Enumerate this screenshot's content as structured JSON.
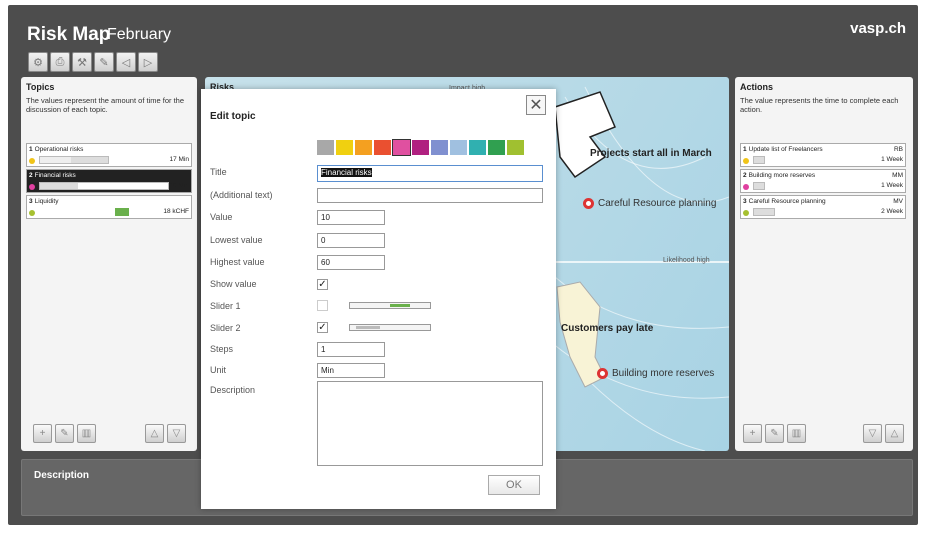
{
  "app": {
    "title": "Risk Map",
    "subtitle": "February",
    "brand": "vasp.ch"
  },
  "toolbar": {
    "icons": [
      "gear-icon",
      "print-icon",
      "tools-icon",
      "edit-icon",
      "back-icon",
      "forward-icon"
    ]
  },
  "topics": {
    "title": "Topics",
    "description": "The values represent the amount of time for the discussion of each topic.",
    "items": [
      {
        "num": "1",
        "label": "Operational risks",
        "value": "17 Min",
        "fraction": 0.45,
        "color": "#f0c419",
        "selected": false
      },
      {
        "num": "2",
        "label": "Financial risks",
        "value": "10 Min",
        "fraction": 0.3,
        "color": "#e040a0",
        "selected": true
      },
      {
        "num": "3",
        "label": "Liquidity",
        "value": "18 kCHF",
        "fraction": 0.6,
        "color": "#a6c030",
        "selected": false
      }
    ]
  },
  "actions": {
    "title": "Actions",
    "description": "The value represents the time to complete each action.",
    "items": [
      {
        "num": "1",
        "label": "Update list of Freelancers",
        "owner": "RB",
        "value": "1 Week",
        "color": "#f0c419"
      },
      {
        "num": "2",
        "label": "Building more reserves",
        "owner": "MM",
        "value": "1 Week",
        "color": "#e040a0"
      },
      {
        "num": "3",
        "label": "Careful Resource planning",
        "owner": "MV",
        "value": "2 Week",
        "color": "#a6c030"
      }
    ]
  },
  "risks": {
    "title": "Risks",
    "impact": "Impact high",
    "likelihood": "Likelihood high",
    "labels": [
      "Projects start all in March",
      "Customers pay late"
    ],
    "actions": [
      "Careful Resource planning",
      "Building more reserves"
    ]
  },
  "description": {
    "title": "Description"
  },
  "dialog": {
    "title": "Edit topic",
    "colors": [
      "#a8a8a8",
      "#f0d010",
      "#f4a020",
      "#ea5030",
      "#e050a0",
      "#b02080",
      "#8090d0",
      "#a0c0e0",
      "#30b0b0",
      "#30a050",
      "#a0c030"
    ],
    "selected_color_index": 4,
    "fields": {
      "title_label": "Title",
      "title_value": "Financial risks",
      "additional_label": "(Additional text)",
      "additional_value": "",
      "value_label": "Value",
      "value_value": "10",
      "lowest_label": "Lowest value",
      "lowest_value": "0",
      "highest_label": "Highest value",
      "highest_value": "60",
      "show_value_label": "Show value",
      "show_value_checked": "✓",
      "slider1_label": "Slider 1",
      "slider1_checked": "",
      "slider2_label": "Slider 2",
      "slider2_checked": "✓",
      "steps_label": "Steps",
      "steps_value": "1",
      "unit_label": "Unit",
      "unit_value": "Min",
      "description_label": "Description"
    },
    "ok_label": "OK",
    "close_label": "✕"
  }
}
